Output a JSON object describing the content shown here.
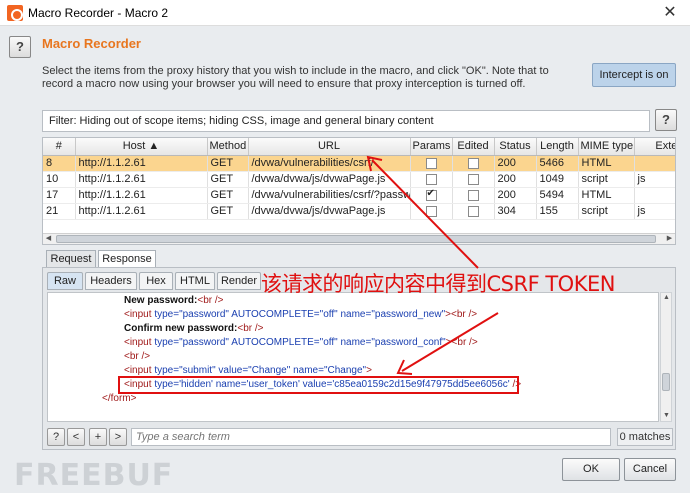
{
  "window": {
    "title": "Macro Recorder - Macro 2",
    "close_glyph": "✕"
  },
  "header": {
    "help_glyph": "?",
    "title": "Macro Recorder",
    "description": "Select the items from the proxy history that you wish to include in the macro, and click \"OK\". Note that to record a macro now using your browser you will need to ensure that proxy interception is turned off.",
    "intercept_button": "Intercept is on"
  },
  "filter": {
    "text": "Filter: Hiding out of scope items;  hiding CSS, image and general binary content",
    "help_glyph": "?"
  },
  "table": {
    "columns": [
      "#",
      "Host ▲",
      "Method",
      "URL",
      "Params",
      "Edited",
      "Status",
      "Length",
      "MIME type",
      "Extensio"
    ],
    "rows": [
      {
        "num": "8",
        "host": "http://1.1.2.61",
        "method": "GET",
        "url": "/dvwa/vulnerabilities/csrf/",
        "params": false,
        "edited": false,
        "status": "200",
        "length": "5466",
        "mime": "HTML",
        "ext": ""
      },
      {
        "num": "10",
        "host": "http://1.1.2.61",
        "method": "GET",
        "url": "/dvwa/dvwa/js/dvwaPage.js",
        "params": false,
        "edited": false,
        "status": "200",
        "length": "1049",
        "mime": "script",
        "ext": "js"
      },
      {
        "num": "17",
        "host": "http://1.1.2.61",
        "method": "GET",
        "url": "/dvwa/vulnerabilities/csrf/?passwo...",
        "params": true,
        "edited": false,
        "status": "200",
        "length": "5494",
        "mime": "HTML",
        "ext": ""
      },
      {
        "num": "21",
        "host": "http://1.1.2.61",
        "method": "GET",
        "url": "/dvwa/dvwa/js/dvwaPage.js",
        "params": false,
        "edited": false,
        "status": "304",
        "length": "155",
        "mime": "script",
        "ext": "js"
      }
    ]
  },
  "tabs": {
    "request": "Request",
    "response": "Response"
  },
  "subtabs": {
    "raw": "Raw",
    "headers": "Headers",
    "hex": "Hex",
    "html": "HTML",
    "render": "Render"
  },
  "code": {
    "l1_text": "New password:",
    "l1_tag": "<br />",
    "l2_a": "<input ",
    "l2_b": "type=",
    "l2_c": "\"password\" ",
    "l2_d": "AUTOCOMPLETE=",
    "l2_e": "\"off\" ",
    "l2_f": "name=",
    "l2_g": "\"password_new\"",
    "l2_h": "><br />",
    "l3_text": "Confirm new password:",
    "l3_tag": "<br />",
    "l4_a": "<input ",
    "l4_b": "type=",
    "l4_c": "\"password\" ",
    "l4_d": "AUTOCOMPLETE=",
    "l4_e": "\"off\" ",
    "l4_f": "name=",
    "l4_g": "\"password_conf\"",
    "l4_h": "><br />",
    "l5": "<br />",
    "l6_a": "<input ",
    "l6_b": "type=",
    "l6_c": "\"submit\" ",
    "l6_d": "value=",
    "l6_e": "\"Change\" ",
    "l6_f": "name=",
    "l6_g": "\"Change\"",
    "l6_h": ">",
    "l7_a": "<input ",
    "l7_b": "type=",
    "l7_c": "'hidden' ",
    "l7_d": "name=",
    "l7_e": "'user_token' ",
    "l7_f": "value=",
    "l7_g": "'c85ea0159c2d15e9f47975dd5ee6056c'",
    "l7_h": " />",
    "l8": "</form>"
  },
  "search": {
    "help": "?",
    "prev": "<",
    "add": "+",
    "next": ">",
    "placeholder": "Type a search term",
    "matches": "0 matches"
  },
  "buttons": {
    "ok": "OK",
    "cancel": "Cancel"
  },
  "annotation": {
    "text": "该请求的响应内容中得到CSRF TOKEN",
    "color": "#e01010"
  },
  "watermark": "FREEBUF"
}
